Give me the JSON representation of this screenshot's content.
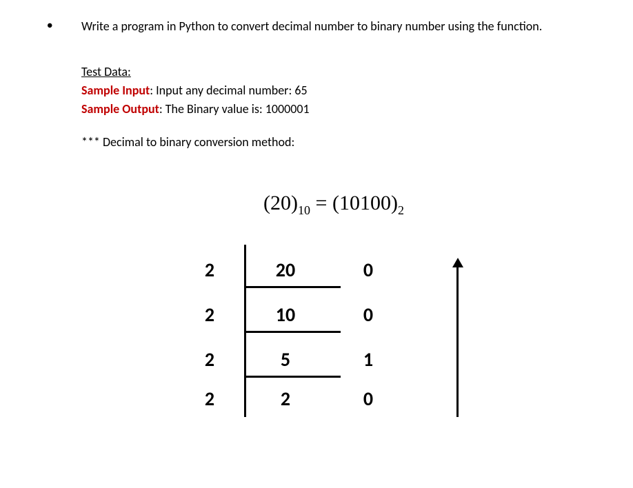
{
  "question": {
    "text": "Write a program in Python to convert decimal number to binary number using the function."
  },
  "testData": {
    "heading": "Test Data:",
    "input_label": "Sample Input",
    "input_text": ": Input any decimal number: 65",
    "output_label": "Sample Output",
    "output_text": ": The Binary value is: 1000001"
  },
  "methodNote": "*** Decimal to binary conversion method:",
  "equation": {
    "left_num": "(20)",
    "left_sub": "10",
    "equals": " = ",
    "right_num": "(10100)",
    "right_sub": "2"
  },
  "divisionSteps": [
    {
      "divisor": "2",
      "quotient": "20",
      "remainder": "0"
    },
    {
      "divisor": "2",
      "quotient": "10",
      "remainder": "0"
    },
    {
      "divisor": "2",
      "quotient": "5",
      "remainder": "1"
    },
    {
      "divisor": "2",
      "quotient": "2",
      "remainder": "0"
    }
  ]
}
